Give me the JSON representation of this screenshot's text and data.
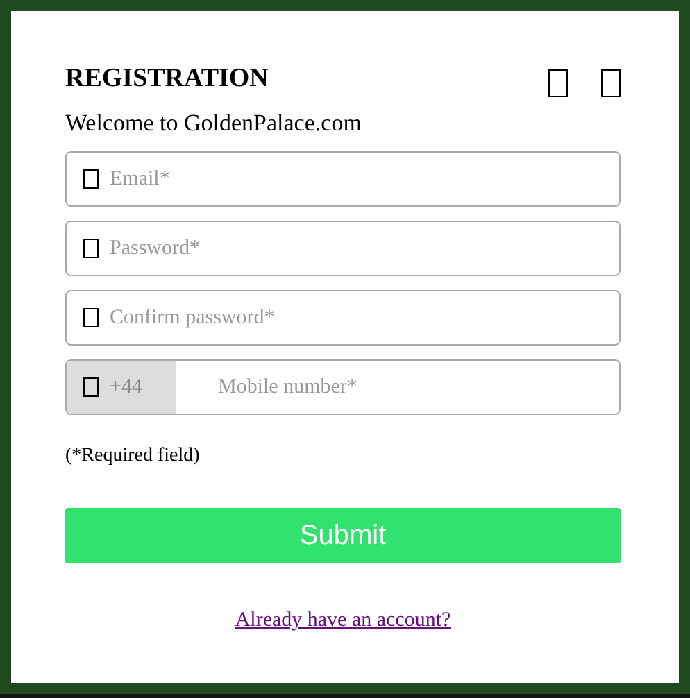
{
  "title": "REGISTRATION",
  "welcome": "Welcome to GoldenPalace.com",
  "fields": [
    {
      "kind": "text",
      "placeholder": "Email*"
    },
    {
      "kind": "text",
      "placeholder": "Password*"
    },
    {
      "kind": "text",
      "placeholder": "Confirm password*"
    },
    {
      "kind": "phone",
      "prefix": "+44",
      "placeholder": "Mobile number*"
    }
  ],
  "note": "(*Required field)",
  "submit": "Submit",
  "login_link": "Already have an account?"
}
